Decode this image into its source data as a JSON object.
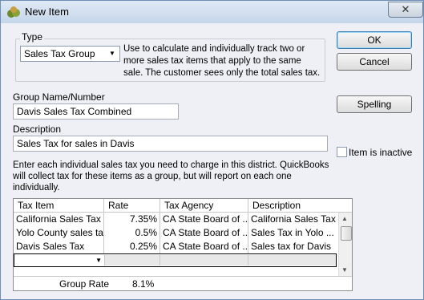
{
  "window": {
    "title": "New Item",
    "close_label": "✕"
  },
  "type": {
    "label": "Type",
    "selected": "Sales Tax Group",
    "description": "Use to calculate and individually track two or more sales tax items that apply to the same sale. The customer sees only the total sales tax."
  },
  "buttons": {
    "ok": "OK",
    "cancel": "Cancel",
    "spelling": "Spelling"
  },
  "group_name": {
    "label": "Group Name/Number",
    "value": "Davis Sales Tax Combined"
  },
  "description": {
    "label": "Description",
    "value": "Sales Tax for sales in Davis"
  },
  "inactive": {
    "label": "Item is inactive",
    "checked": false
  },
  "info": "Enter each individual sales tax you need to charge in this district.  QuickBooks will collect tax for these items as a group, but will report on each one individually.",
  "table": {
    "headers": [
      "Tax Item",
      "Rate",
      "Tax Agency",
      "Description"
    ],
    "rows": [
      {
        "item": "California Sales Tax",
        "rate": "7.35%",
        "agency": "CA State Board of ...",
        "description": "California Sales Tax"
      },
      {
        "item": "Yolo County sales tax",
        "rate": "0.5%",
        "agency": "CA State Board of ...",
        "description": "Sales Tax in Yolo ..."
      },
      {
        "item": "Davis Sales Tax",
        "rate": "0.25%",
        "agency": "CA State Board of ...",
        "description": "Sales tax for Davis"
      }
    ],
    "group_rate_label": "Group Rate",
    "group_rate_value": "8.1%"
  },
  "colors": {
    "accent": "#3c7fb1",
    "window_bg": "#eff0f5"
  }
}
